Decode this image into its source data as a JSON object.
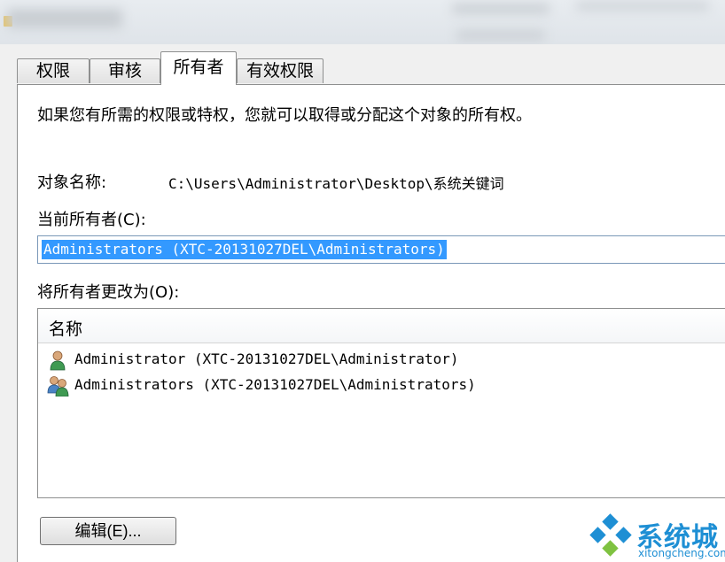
{
  "tabs": [
    {
      "label": "权限"
    },
    {
      "label": "审核"
    },
    {
      "label": "所有者"
    },
    {
      "label": "有效权限"
    }
  ],
  "intro": "如果您有所需的权限或特权，您就可以取得或分配这个对象的所有权。",
  "object_name": {
    "label": "对象名称:",
    "value": "C:\\Users\\Administrator\\Desktop\\系统关键词"
  },
  "current_owner": {
    "label": "当前所有者(C):",
    "value": "Administrators (XTC-20131027DEL\\Administrators)"
  },
  "change_owner": {
    "label": "将所有者更改为(O):",
    "column_header": "名称",
    "items": [
      {
        "label": "Administrator (XTC-20131027DEL\\Administrator)",
        "icon": "user-icon"
      },
      {
        "label": "Administrators (XTC-20131027DEL\\Administrators)",
        "icon": "group-icon"
      }
    ]
  },
  "edit_button": "编辑(E)...",
  "watermark": {
    "brand": "系统城",
    "site": "xitongcheng.com"
  },
  "colors": {
    "selection": "#3399ff",
    "brand": "#1e8fd4"
  }
}
